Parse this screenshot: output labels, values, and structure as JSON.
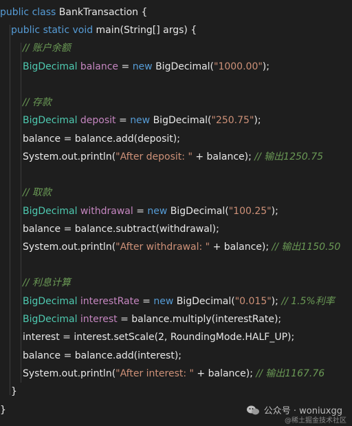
{
  "code": {
    "l1": {
      "kw": "public class ",
      "name": "BankTransaction {"
    },
    "l2": {
      "kw": "public static void ",
      "rest": "main(String[] args) {"
    },
    "l3": {
      "comment": "// 账户余额"
    },
    "l4": {
      "type": "BigDecimal ",
      "var": "balance",
      "eq": " = ",
      "new": "new ",
      "ctor": "BigDecimal(",
      "str": "\"1000.00\"",
      "end": ");"
    },
    "l6": {
      "comment": "// 存款"
    },
    "l7": {
      "type": "BigDecimal ",
      "var": "deposit",
      "eq": " = ",
      "new": "new ",
      "ctor": "BigDecimal(",
      "str": "\"250.75\"",
      "end": ");"
    },
    "l8": {
      "text": "balance = balance.add(deposit);"
    },
    "l9": {
      "pre": "System.out.println(",
      "str": "\"After deposit: \"",
      "post": " + balance); ",
      "comment": "// 输出1250.75"
    },
    "l11": {
      "comment": "// 取款"
    },
    "l12": {
      "type": "BigDecimal ",
      "var": "withdrawal",
      "eq": " = ",
      "new": "new ",
      "ctor": "BigDecimal(",
      "str": "\"100.25\"",
      "end": ");"
    },
    "l13": {
      "text": "balance = balance.subtract(withdrawal);"
    },
    "l14": {
      "pre": "System.out.println(",
      "str": "\"After withdrawal: \"",
      "post": " + balance); ",
      "comment": "// 输出1150.50"
    },
    "l16": {
      "comment": "// 利息计算"
    },
    "l17": {
      "type": "BigDecimal ",
      "var": "interestRate",
      "eq": " = ",
      "new": "new ",
      "ctor": "BigDecimal(",
      "str": "\"0.015\"",
      "end": "); ",
      "comment": "// 1.5%利率"
    },
    "l18": {
      "type": "BigDecimal ",
      "var": "interest",
      "rest": " = balance.multiply(interestRate);"
    },
    "l19": {
      "text": "interest = interest.setScale(2, RoundingMode.HALF_UP);"
    },
    "l20": {
      "text": "balance = balance.add(interest);"
    },
    "l21": {
      "pre": "System.out.println(",
      "str": "\"After interest: \"",
      "post": " + balance); ",
      "comment": "// 输出1167.76"
    },
    "l22": {
      "text": "}"
    },
    "l23": {
      "text": "}"
    }
  },
  "watermark": {
    "main": "公众号 · woniuxgg",
    "sub": "@稀土掘金技术社区",
    "logo_icon": "wechat-icon"
  }
}
